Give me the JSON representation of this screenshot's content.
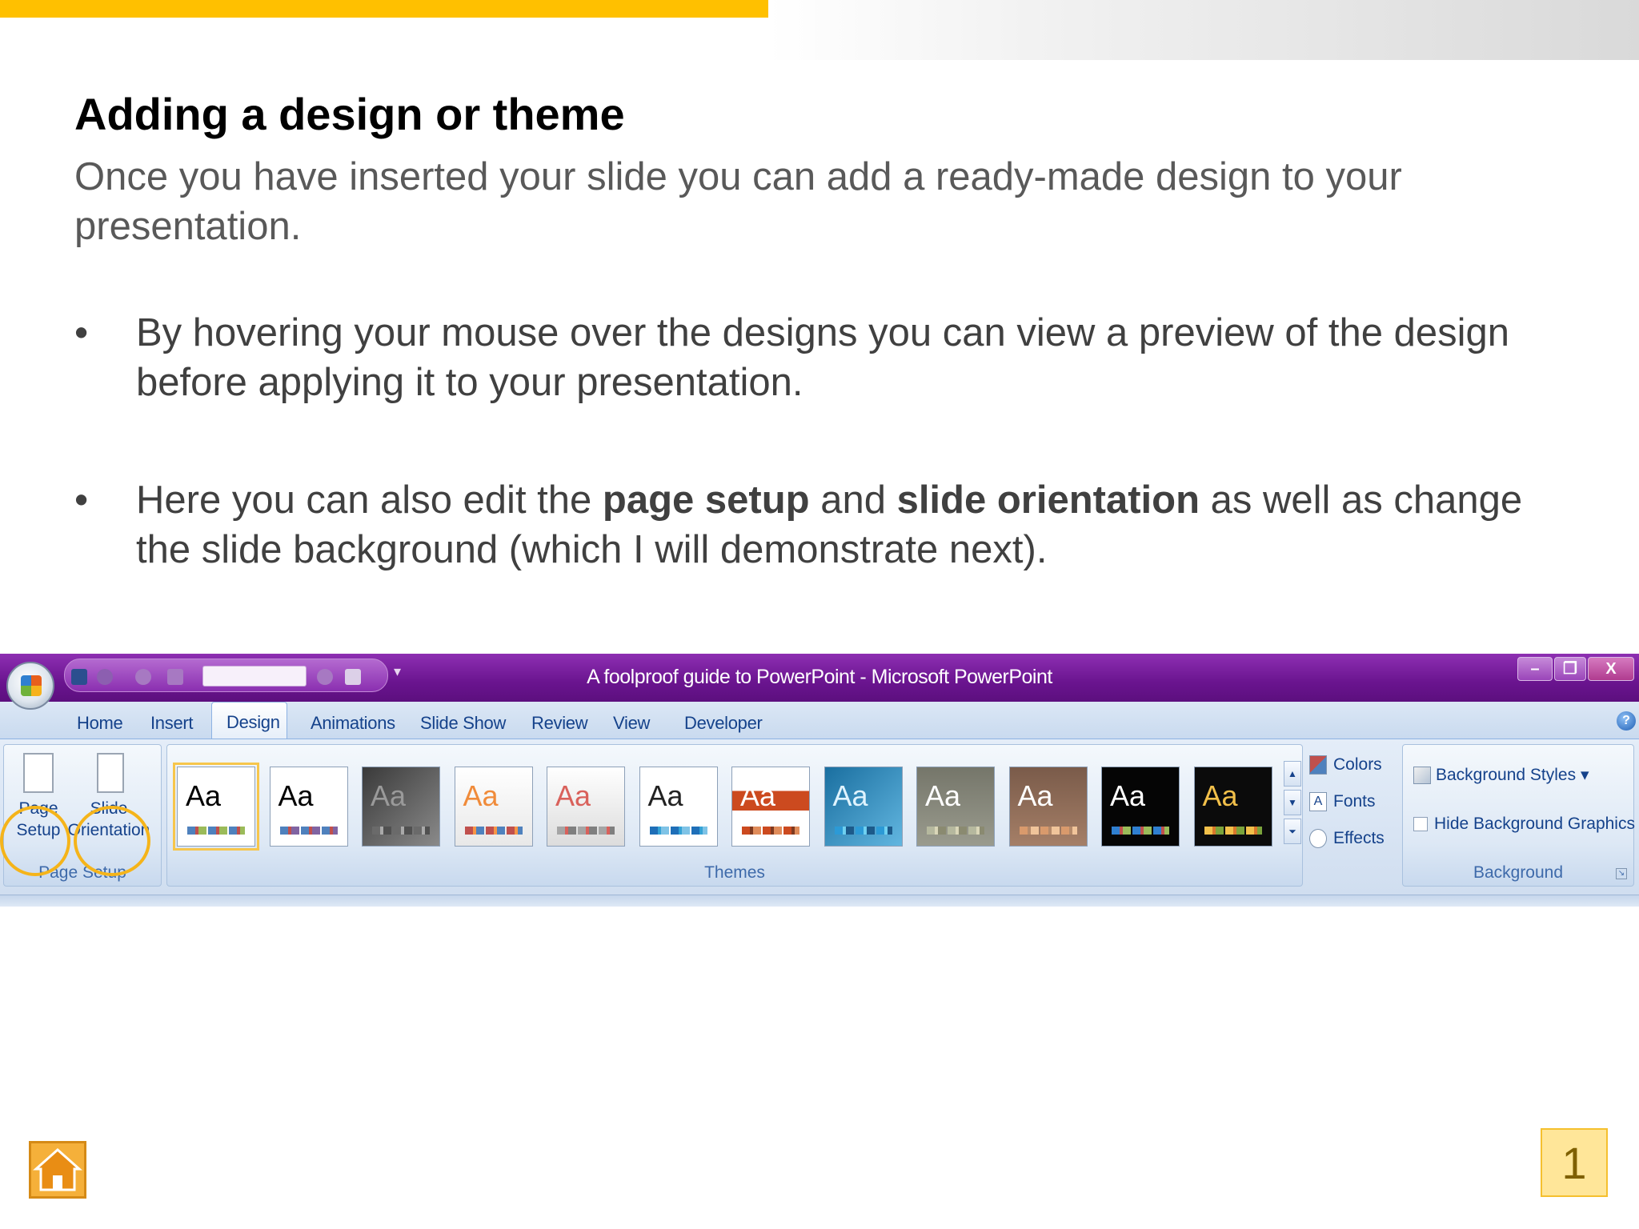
{
  "slide": {
    "title": "Adding a design or theme",
    "intro": "Once you have inserted your slide you can add a ready-made design to your presentation.",
    "bullet_symbol": "•",
    "bullets": [
      {
        "text": "By hovering your mouse over the designs you can view a preview of the design before applying it to your presentation."
      },
      {
        "pre": "Here you can also edit the ",
        "bold1": "page setup",
        "mid": " and ",
        "bold2": "slide orientation",
        "post": " as well as change the slide background (which I will demonstrate next)."
      }
    ],
    "page_number": "1"
  },
  "ppt": {
    "window_title": "A foolproof guide to PowerPoint - Microsoft PowerPoint",
    "window_controls": [
      "–",
      "❐",
      "X"
    ],
    "tabs": [
      "Home",
      "Insert",
      "Design",
      "Animations",
      "Slide Show",
      "Review",
      "View",
      "Developer"
    ],
    "active_tab": "Design",
    "help": "?",
    "groups": {
      "page_setup": {
        "label": "Page Setup",
        "page_setup_btn": "Page Setup",
        "slide_orientation_btn": "Slide Orientation"
      },
      "themes": {
        "label": "Themes",
        "thumb_text": "Aa",
        "themes": [
          {
            "bg": "#ffffff",
            "fg": "#000000",
            "sw1": "#4f81bd",
            "sw2": "#c0504d",
            "sw3": "#9bbb59"
          },
          {
            "bg": "#ffffff",
            "fg": "#000000",
            "sw1": "#4f81bd",
            "sw2": "#c0504d",
            "sw3": "#8064a2"
          },
          {
            "bg": "linear-gradient(135deg,#3a3a3a,#8a8a8a)",
            "fg": "#9a9a9a",
            "sw1": "#6a6a6a",
            "sw2": "#a9a9a9",
            "sw3": "#505050"
          },
          {
            "bg": "linear-gradient(#ffffff,#e8e8e8)",
            "fg": "#f08b3a",
            "sw1": "#c0504d",
            "sw2": "#f79646",
            "sw3": "#4f81bd"
          },
          {
            "bg": "linear-gradient(#ffffff,#dcdcdc)",
            "fg": "#d9615b",
            "sw1": "#a5a5a5",
            "sw2": "#d9615b",
            "sw3": "#7f7f7f"
          },
          {
            "bg": "#ffffff",
            "fg": "#222222",
            "sw1": "#1f6fb8",
            "sw2": "#35a3d6",
            "sw3": "#7fc3e6"
          },
          {
            "bg": "linear-gradient(#ffffff 0 30%,#cc4a1f 30% 55%,#ffffff 55%)",
            "fg": "#ffffff",
            "sw1": "#cc4a1f",
            "sw2": "#7f3a1f",
            "sw3": "#e08c5a"
          },
          {
            "bg": "linear-gradient(135deg,#1a6fa0,#62b6e0)",
            "fg": "#e0f4ff",
            "sw1": "#2c9ad6",
            "sw2": "#6fd0f0",
            "sw3": "#1c5a8a"
          },
          {
            "bg": "linear-gradient(#75766a,#9a9b8e)",
            "fg": "#ffffff",
            "sw1": "#b5b89e",
            "sw2": "#d9d6b8",
            "sw3": "#8a8a70"
          },
          {
            "bg": "linear-gradient(#7a5b4a,#a57f67)",
            "fg": "#ffffff",
            "sw1": "#d99a6c",
            "sw2": "#b58a6a",
            "sw3": "#f0c49a"
          },
          {
            "bg": "#050505",
            "fg": "#ffffff",
            "sw1": "#2f7fd0",
            "sw2": "#c0504d",
            "sw3": "#9bbb59"
          },
          {
            "bg": "#0b0b0b",
            "fg": "#f2c04a",
            "sw1": "#f2c04a",
            "sw2": "#d9772b",
            "sw3": "#7aa33b"
          }
        ],
        "scroll": [
          "▲",
          "▼",
          "⏷"
        ]
      },
      "theme_options": {
        "colors": "Colors",
        "fonts": "Fonts",
        "effects": "Effects"
      },
      "background": {
        "label": "Background",
        "background_styles": "Background Styles",
        "hide_graphics": "Hide Background Graphics"
      }
    }
  },
  "colors": {
    "accent_bar": "#ffc000",
    "titlebar": "#6a148f",
    "ribbon_text": "#15428b",
    "highlight_ring": "#f5b41a"
  },
  "icons": [
    "office-button-icon",
    "save-icon",
    "undo-icon",
    "redo-icon",
    "help-icon",
    "home-icon",
    "colors-icon",
    "fonts-icon",
    "effects-icon",
    "background-styles-icon"
  ]
}
